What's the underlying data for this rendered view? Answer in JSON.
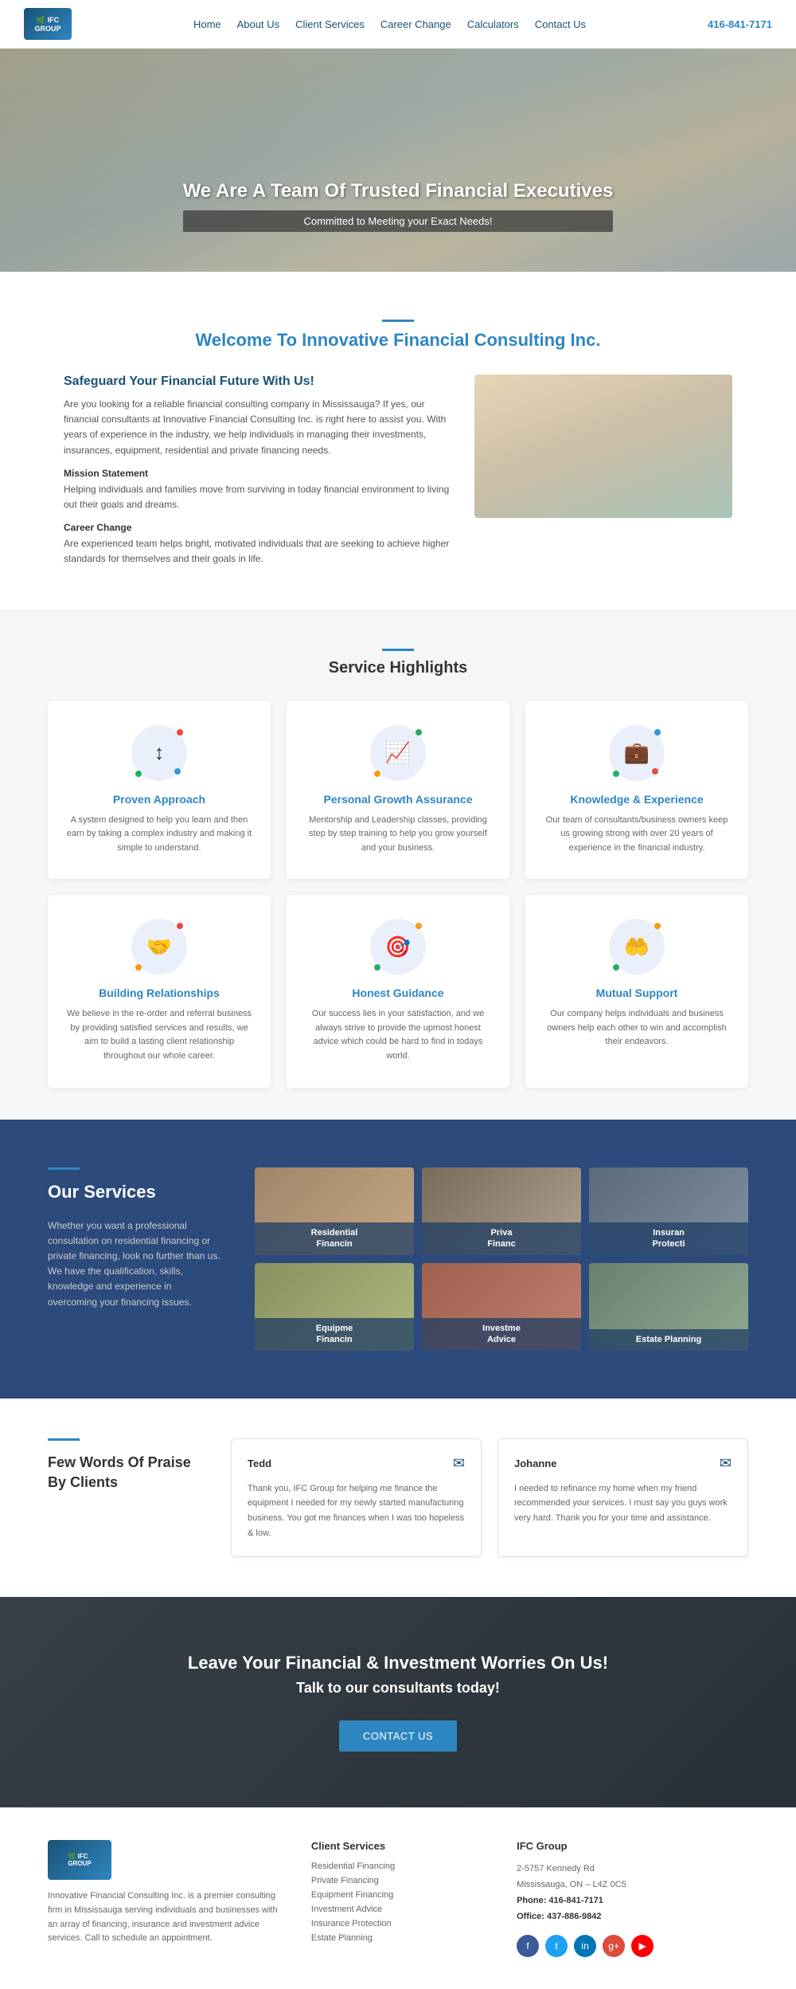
{
  "nav": {
    "logo_text": "IFC GROUP",
    "links": [
      "Home",
      "About Us",
      "Client Services",
      "Career Change",
      "Calculators",
      "Contact Us"
    ],
    "phone": "416-841-7171"
  },
  "hero": {
    "heading": "We Are A Team Of Trusted Financial Executives",
    "subheading": "Committed to Meeting your Exact Needs!"
  },
  "welcome": {
    "heading": "Welcome To Innovative Financial Consulting Inc.",
    "intro_heading": "Safeguard Your Financial Future With Us!",
    "intro_text": "Are you looking for a reliable financial consulting company in Mississauga? If yes, our financial consultants at Innovative Financial Consulting Inc. is right here to assist you. With years of experience in the industry, we help individuals in managing their investments, insurances, equipment, residential and private financing needs.",
    "mission_title": "Mission Statement",
    "mission_text": "Helping individuals and families move from surviving in today financial environment to living out their goals and dreams.",
    "career_title": "Career Change",
    "career_text": "Are experienced team helps bright, motivated individuals that are seeking to achieve higher standards for themselves and their goals in life."
  },
  "service_highlights": {
    "heading": "Service Highlights",
    "divider_line": "",
    "cards": [
      {
        "title": "Proven Approach",
        "description": "A system designed to help you learn and then earn by taking a complex industry and making it simple to understand.",
        "icon": "↕",
        "dot_colors": [
          "#e74c3c",
          "#27ae60",
          "#3498db"
        ]
      },
      {
        "title": "Personal Growth Assurance",
        "description": "Mentorship and Leadership classes, providing step by step training to help you grow yourself and your business.",
        "icon": "📈",
        "dot_colors": [
          "#27ae60",
          "#f39c12"
        ]
      },
      {
        "title": "Knowledge & Experience",
        "description": "Our team of consultants/business owners keep us growing strong with over 20 years of experience in the financial industry.",
        "icon": "💼",
        "dot_colors": [
          "#3498db",
          "#27ae60",
          "#e74c3c"
        ]
      },
      {
        "title": "Building Relationships",
        "description": "We believe in the re-order and referral business by providing satisfied services and results, we aim to build a lasting client relationship throughout our whole career.",
        "icon": "🤝",
        "dot_colors": [
          "#e74c3c",
          "#f39c12"
        ]
      },
      {
        "title": "Honest Guidance",
        "description": "Our success lies in your satisfaction, and we always strive to provide the upmost honest advice which could be hard to find in todays world.",
        "icon": "🎯",
        "dot_colors": [
          "#f39c12",
          "#27ae60"
        ]
      },
      {
        "title": "Mutual Support",
        "description": "Our company helps individuals and business owners help each other to win and accomplish their endeavors.",
        "icon": "🤲",
        "dot_colors": [
          "#f39c12",
          "#27ae60"
        ]
      }
    ]
  },
  "our_services": {
    "heading": "Our Services",
    "description": "Whether you want a professional consultation on residential financing or private financing, look no further than us. We have the qualification, skills, knowledge and experience in overcoming your financing issues.",
    "tiles": [
      {
        "label": "Residential\nFinancin",
        "bg_class": "t1"
      },
      {
        "label": "Priva\nFinanc",
        "bg_class": "t2"
      },
      {
        "label": "Insuran\nProtecti",
        "bg_class": "t3"
      },
      {
        "label": "Equipme\nFinancin",
        "bg_class": "t4"
      },
      {
        "label": "Investme\nAdvice",
        "bg_class": "t5"
      },
      {
        "label": "Estate Planning",
        "bg_class": "t6"
      }
    ]
  },
  "testimonials": {
    "heading": "Few Words Of Praise By Clients",
    "items": [
      {
        "name": "Tedd",
        "text": "Thank you, IFC Group for helping me finance the equipment I needed for my newly started manufacturing business. You got me finances when I was too hopeless & low."
      },
      {
        "name": "Johanne",
        "text": "I needed to refinance my home when my friend recommended your services. I must say you guys work very hard. Thank you for your time and assistance."
      }
    ]
  },
  "cta": {
    "heading": "Leave Your Financial & Investment Worries On Us!",
    "subheading": "Talk to our consultants today!",
    "button_label": "CONTACT US"
  },
  "footer": {
    "logo_text": "IFC GROUP",
    "about_text": "Innovative Financial Consulting Inc. is a premier consulting firm in Mississauga serving individuals and businesses with an array of financing, insurance and investment advice services. Call to schedule an appointment.",
    "client_services": {
      "heading": "Client Services",
      "links": [
        "Residential Financing",
        "Private Financing",
        "Equipment Financing",
        "Investment Advice",
        "Insurance Protection",
        "Estate Planning"
      ]
    },
    "ifc_group": {
      "heading": "IFC Group",
      "address": "2-5757 Kennedy Rd\nMississauga, ON – L4Z 0C5",
      "phone": "Phone: 416-841-7171",
      "office": "Office: 437-886-9842"
    },
    "social": [
      "fb",
      "tw",
      "li",
      "gp",
      "yt"
    ]
  }
}
